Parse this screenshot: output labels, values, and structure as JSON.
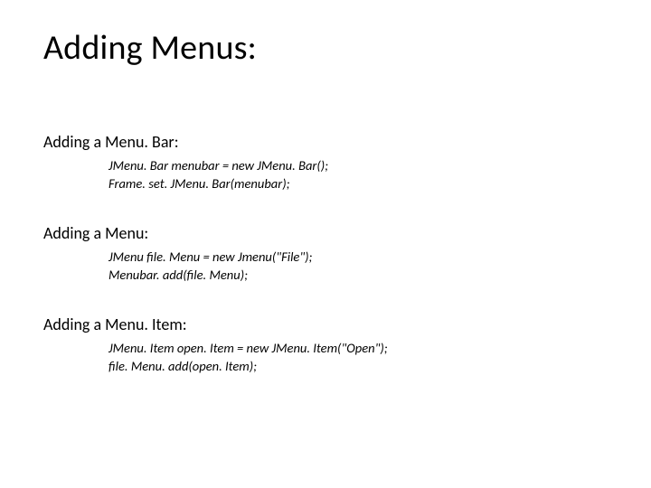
{
  "title": "Adding Menus:",
  "sections": [
    {
      "heading": "Adding a Menu. Bar:",
      "lines": [
        "JMenu. Bar menubar = new JMenu. Bar();",
        "Frame. set. JMenu. Bar(menubar);"
      ]
    },
    {
      "heading": "Adding a Menu:",
      "lines": [
        "JMenu file. Menu = new Jmenu(\"File\");",
        "Menubar. add(file. Menu);"
      ]
    },
    {
      "heading": "Adding a Menu. Item:",
      "lines": [
        "JMenu. Item open. Item = new JMenu. Item(\"Open\");",
        "file. Menu. add(open. Item);"
      ]
    }
  ]
}
